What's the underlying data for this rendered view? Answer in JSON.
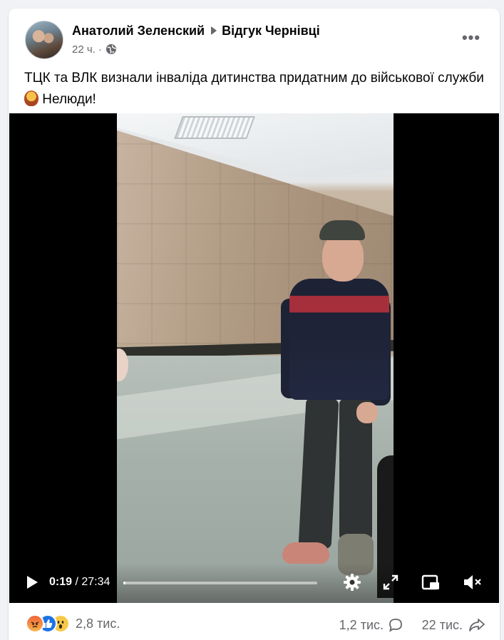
{
  "post": {
    "author": "Анатолий Зеленский",
    "group": "Відгук Чернівці",
    "time": "22 ч. ·",
    "text": "ТЦК та ВЛК визнали інваліда дитинства придатним до військової служби",
    "text_suffix": "Нелюди!",
    "more_label": "•••"
  },
  "video": {
    "current_time": "0:19",
    "separator": " / ",
    "duration": "27:34",
    "progress_fraction": 0.0115
  },
  "footer": {
    "reactions_count": "2,8 тис.",
    "comments_count": "1,2 тис.",
    "shares_count": "22 тис."
  },
  "icons": {
    "reactions": [
      "angry-icon",
      "like-icon",
      "wow-icon"
    ],
    "privacy": "globe-icon",
    "emoji": "facepalm-emoji-icon"
  },
  "colors": {
    "background": "#f0f2f5",
    "secondary_text": "#65676b",
    "like_blue": "#1b74e4"
  }
}
